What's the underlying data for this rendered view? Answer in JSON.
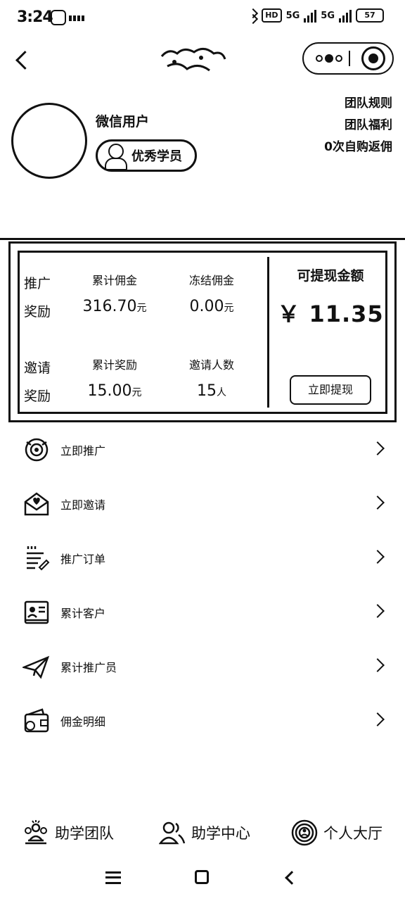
{
  "status_bar": {
    "time": "3:24",
    "hd": "HD",
    "network_1": "5G",
    "network_2": "5G",
    "battery": "57"
  },
  "profile": {
    "user_name": "微信用户",
    "member_level": "优秀学员",
    "links": [
      "团队规则",
      "团队福利",
      "0次自购返佣"
    ]
  },
  "promotion_reward": {
    "title": "推广奖励",
    "title_line1": "推广",
    "title_line2": "奖励",
    "total_commission_label": "累计佣金",
    "total_commission_value": "316.70",
    "frozen_commission_label": "冻结佣金",
    "frozen_commission_value": "0.00",
    "unit": "元"
  },
  "invite_reward": {
    "title_line1": "邀请",
    "title_line2": "奖励",
    "total_reward_label": "累计奖励",
    "total_reward_value": "15.00",
    "reward_unit": "元",
    "invite_count_label": "邀请人数",
    "invite_count_value": "15",
    "count_unit": "人"
  },
  "balance": {
    "label": "可提现金额",
    "value": "￥ 11.35",
    "withdraw_button": "立即提现"
  },
  "menu": [
    {
      "label": "立即推广",
      "icon": "promote-icon"
    },
    {
      "label": "立即邀请",
      "icon": "invite-envelope-icon"
    },
    {
      "label": "推广订单",
      "icon": "order-list-icon"
    },
    {
      "label": "累计客户",
      "icon": "customer-card-icon"
    },
    {
      "label": "累计推广员",
      "icon": "paper-plane-icon"
    },
    {
      "label": "佣金明细",
      "icon": "wallet-icon"
    }
  ],
  "tabbar": [
    {
      "label": "助学团队",
      "icon": "team-icon"
    },
    {
      "label": "助学中心",
      "icon": "users-icon"
    },
    {
      "label": "个人大厅",
      "icon": "target-icon"
    }
  ]
}
